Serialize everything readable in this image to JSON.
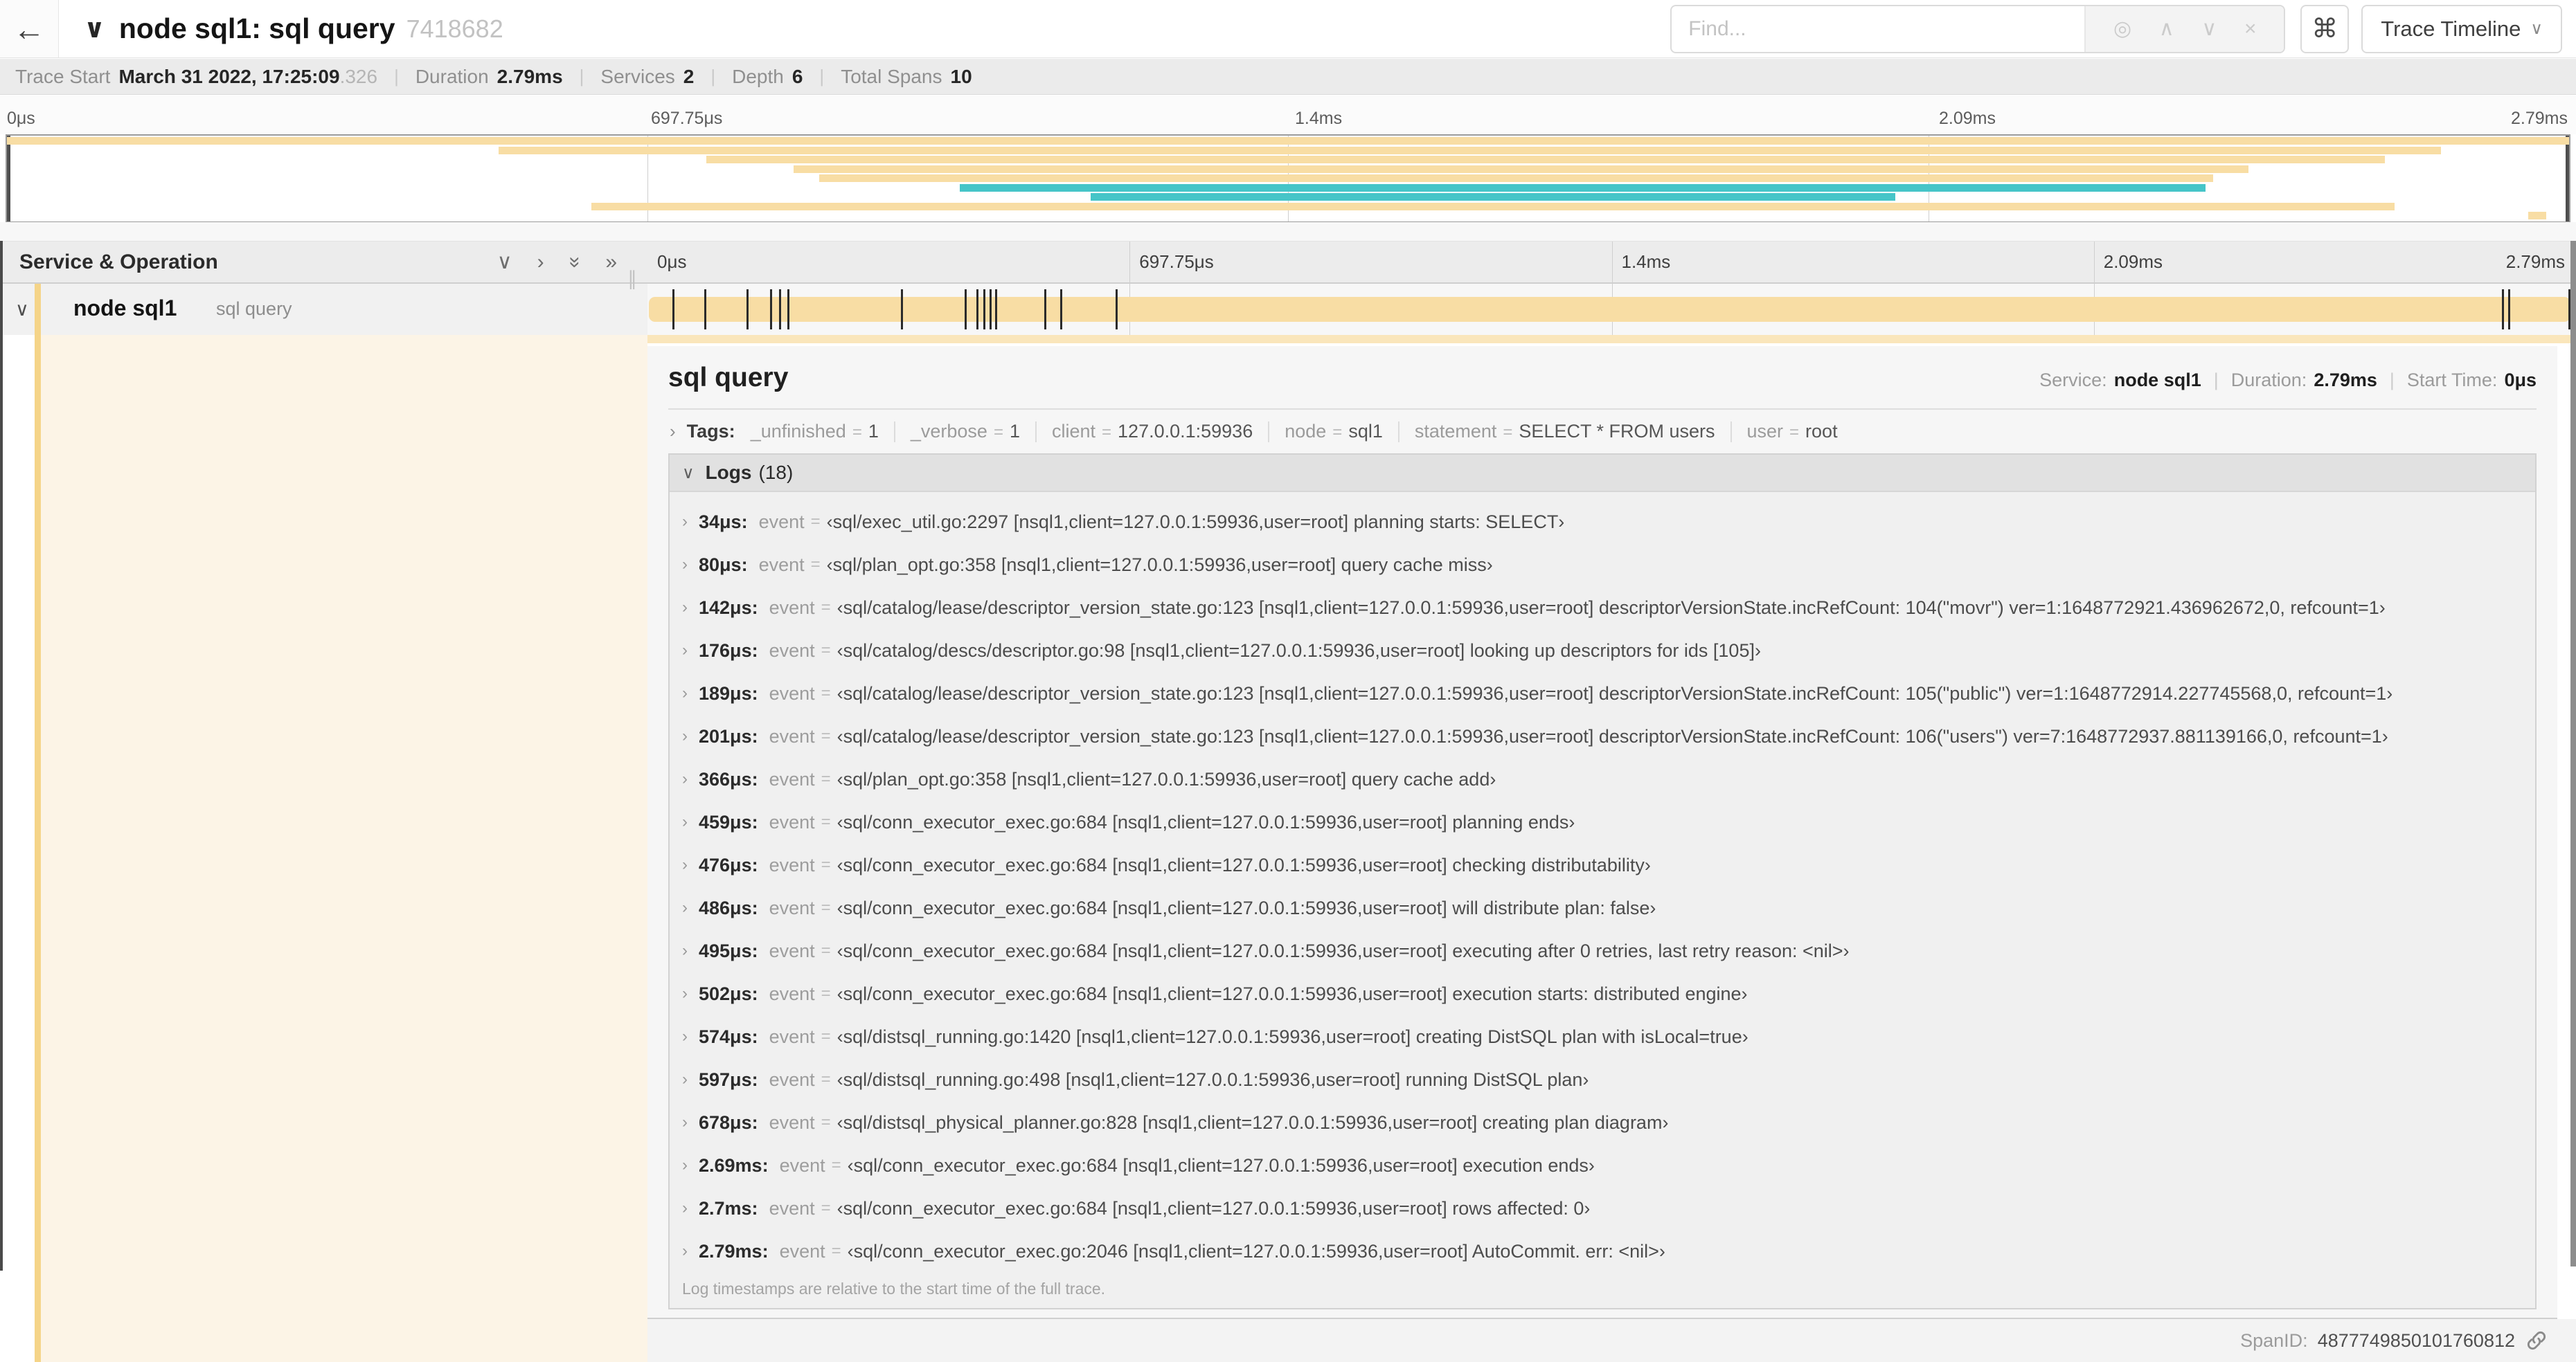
{
  "colors": {
    "span_tan": "#F8DDA4",
    "span_teal": "#46C5C8",
    "accent_tan": "#F5D488",
    "cream_bg": "#FCF4E6",
    "tick_black": "#2b2b2b"
  },
  "separators": {
    "pipe": "|",
    "eq": "=",
    "drag": "∥"
  },
  "topbar": {
    "back_icon": "←",
    "collapse_icon": "∨",
    "title": "node sql1: sql query",
    "trace_id": "7418682",
    "find_placeholder": "Find...",
    "find_icons": [
      {
        "name": "locate-icon",
        "glyph": "◎"
      },
      {
        "name": "prev-result-icon",
        "glyph": "∧"
      },
      {
        "name": "next-result-icon",
        "glyph": "∨"
      },
      {
        "name": "clear-search-icon",
        "glyph": "×"
      }
    ],
    "shortcut_icon": "⌘",
    "view_button": {
      "label": "Trace Timeline",
      "caret": "∨"
    }
  },
  "metabar": {
    "items": [
      {
        "label": "Trace Start",
        "value": "March 31 2022, 17:25:09",
        "suffix": ".326"
      },
      {
        "label": "Duration",
        "value": "2.79ms"
      },
      {
        "label": "Services",
        "value": "2"
      },
      {
        "label": "Depth",
        "value": "6"
      },
      {
        "label": "Total Spans",
        "value": "10"
      }
    ]
  },
  "ticks": [
    {
      "label": "0μs",
      "pct": 0
    },
    {
      "label": "697.75μs",
      "pct": 25
    },
    {
      "label": "1.4ms",
      "pct": 50
    },
    {
      "label": "2.09ms",
      "pct": 75
    },
    {
      "label": "2.79ms",
      "pct": 100
    }
  ],
  "minimap": {
    "spans": [
      {
        "start": 0,
        "width": 100,
        "color": "tan"
      },
      {
        "start": 19.2,
        "width": 75.8,
        "color": "tan"
      },
      {
        "start": 27.3,
        "width": 65.5,
        "color": "tan"
      },
      {
        "start": 30.7,
        "width": 56.8,
        "color": "tan"
      },
      {
        "start": 31.7,
        "width": 54.4,
        "color": "tan"
      },
      {
        "start": 37.2,
        "width": 48.6,
        "color": "teal"
      },
      {
        "start": 42.3,
        "width": 31.4,
        "color": "teal"
      },
      {
        "start": 22.8,
        "width": 70.4,
        "color": "tan"
      },
      {
        "start": 98.4,
        "width": 0.7,
        "color": "tan"
      }
    ]
  },
  "timeline": {
    "left_header": "Service & Operation",
    "controls": [
      {
        "name": "collapse-one-icon",
        "glyph": "∨",
        "rotate": false
      },
      {
        "name": "expand-one-icon",
        "glyph": "›",
        "rotate": false
      },
      {
        "name": "collapse-all-icon",
        "glyph": "»",
        "rotate": true
      },
      {
        "name": "expand-all-icon",
        "glyph": "»",
        "rotate": false
      }
    ],
    "row": {
      "chevron": "∨",
      "service": "node sql1",
      "operation": "sql query"
    },
    "log_marker_pcts": [
      1.22,
      2.87,
      5.09,
      6.31,
      6.77,
      7.2,
      13.12,
      16.45,
      17.06,
      17.42,
      17.74,
      18.0,
      20.57,
      21.4,
      24.3,
      96.42,
      96.77,
      99.9
    ]
  },
  "detail": {
    "title": "sql query",
    "meta": [
      {
        "label": "Service:",
        "value": "node sql1"
      },
      {
        "label": "Duration:",
        "value": "2.79ms"
      },
      {
        "label": "Start Time:",
        "value": "0μs"
      }
    ],
    "tags_toggle": "›",
    "tags_label": "Tags:",
    "tags": [
      {
        "key": "_unfinished",
        "value": "1"
      },
      {
        "key": "_verbose",
        "value": "1"
      },
      {
        "key": "client",
        "value": "127.0.0.1:59936"
      },
      {
        "key": "node",
        "value": "sql1"
      },
      {
        "key": "statement",
        "value": "SELECT * FROM users"
      },
      {
        "key": "user",
        "value": "root"
      }
    ],
    "logs_toggle": "∨",
    "logs_label": "Logs",
    "logs_count": "(18)",
    "log_key": "event",
    "log_row_toggle": "›",
    "logs": [
      {
        "time": "34μs:",
        "value": "‹sql/exec_util.go:2297 [nsql1,client=127.0.0.1:59936,user=root] planning starts: SELECT›"
      },
      {
        "time": "80μs:",
        "value": "‹sql/plan_opt.go:358 [nsql1,client=127.0.0.1:59936,user=root] query cache miss›"
      },
      {
        "time": "142μs:",
        "value": "‹sql/catalog/lease/descriptor_version_state.go:123 [nsql1,client=127.0.0.1:59936,user=root] descriptorVersionState.incRefCount: 104(\"movr\") ver=1:1648772921.436962672,0, refcount=1›"
      },
      {
        "time": "176μs:",
        "value": "‹sql/catalog/descs/descriptor.go:98 [nsql1,client=127.0.0.1:59936,user=root] looking up descriptors for ids [105]›"
      },
      {
        "time": "189μs:",
        "value": "‹sql/catalog/lease/descriptor_version_state.go:123 [nsql1,client=127.0.0.1:59936,user=root] descriptorVersionState.incRefCount: 105(\"public\") ver=1:1648772914.227745568,0, refcount=1›"
      },
      {
        "time": "201μs:",
        "value": "‹sql/catalog/lease/descriptor_version_state.go:123 [nsql1,client=127.0.0.1:59936,user=root] descriptorVersionState.incRefCount: 106(\"users\") ver=7:1648772937.881139166,0, refcount=1›"
      },
      {
        "time": "366μs:",
        "value": "‹sql/plan_opt.go:358 [nsql1,client=127.0.0.1:59936,user=root] query cache add›"
      },
      {
        "time": "459μs:",
        "value": "‹sql/conn_executor_exec.go:684 [nsql1,client=127.0.0.1:59936,user=root] planning ends›"
      },
      {
        "time": "476μs:",
        "value": "‹sql/conn_executor_exec.go:684 [nsql1,client=127.0.0.1:59936,user=root] checking distributability›"
      },
      {
        "time": "486μs:",
        "value": "‹sql/conn_executor_exec.go:684 [nsql1,client=127.0.0.1:59936,user=root] will distribute plan: false›"
      },
      {
        "time": "495μs:",
        "value": "‹sql/conn_executor_exec.go:684 [nsql1,client=127.0.0.1:59936,user=root] executing after 0 retries, last retry reason: <nil>›"
      },
      {
        "time": "502μs:",
        "value": "‹sql/conn_executor_exec.go:684 [nsql1,client=127.0.0.1:59936,user=root] execution starts: distributed engine›"
      },
      {
        "time": "574μs:",
        "value": "‹sql/distsql_running.go:1420 [nsql1,client=127.0.0.1:59936,user=root] creating DistSQL plan with isLocal=true›"
      },
      {
        "time": "597μs:",
        "value": "‹sql/distsql_running.go:498 [nsql1,client=127.0.0.1:59936,user=root] running DistSQL plan›"
      },
      {
        "time": "678μs:",
        "value": "‹sql/distsql_physical_planner.go:828 [nsql1,client=127.0.0.1:59936,user=root] creating plan diagram›"
      },
      {
        "time": "2.69ms:",
        "value": "‹sql/conn_executor_exec.go:684 [nsql1,client=127.0.0.1:59936,user=root] execution ends›"
      },
      {
        "time": "2.7ms:",
        "value": "‹sql/conn_executor_exec.go:684 [nsql1,client=127.0.0.1:59936,user=root] rows affected: 0›"
      },
      {
        "time": "2.79ms:",
        "value": "‹sql/conn_executor_exec.go:2046 [nsql1,client=127.0.0.1:59936,user=root] AutoCommit. err: <nil>›"
      }
    ],
    "footer": "Log timestamps are relative to the start time of the full trace.",
    "spanid_label": "SpanID:",
    "spanid": "4877749850101760812"
  }
}
